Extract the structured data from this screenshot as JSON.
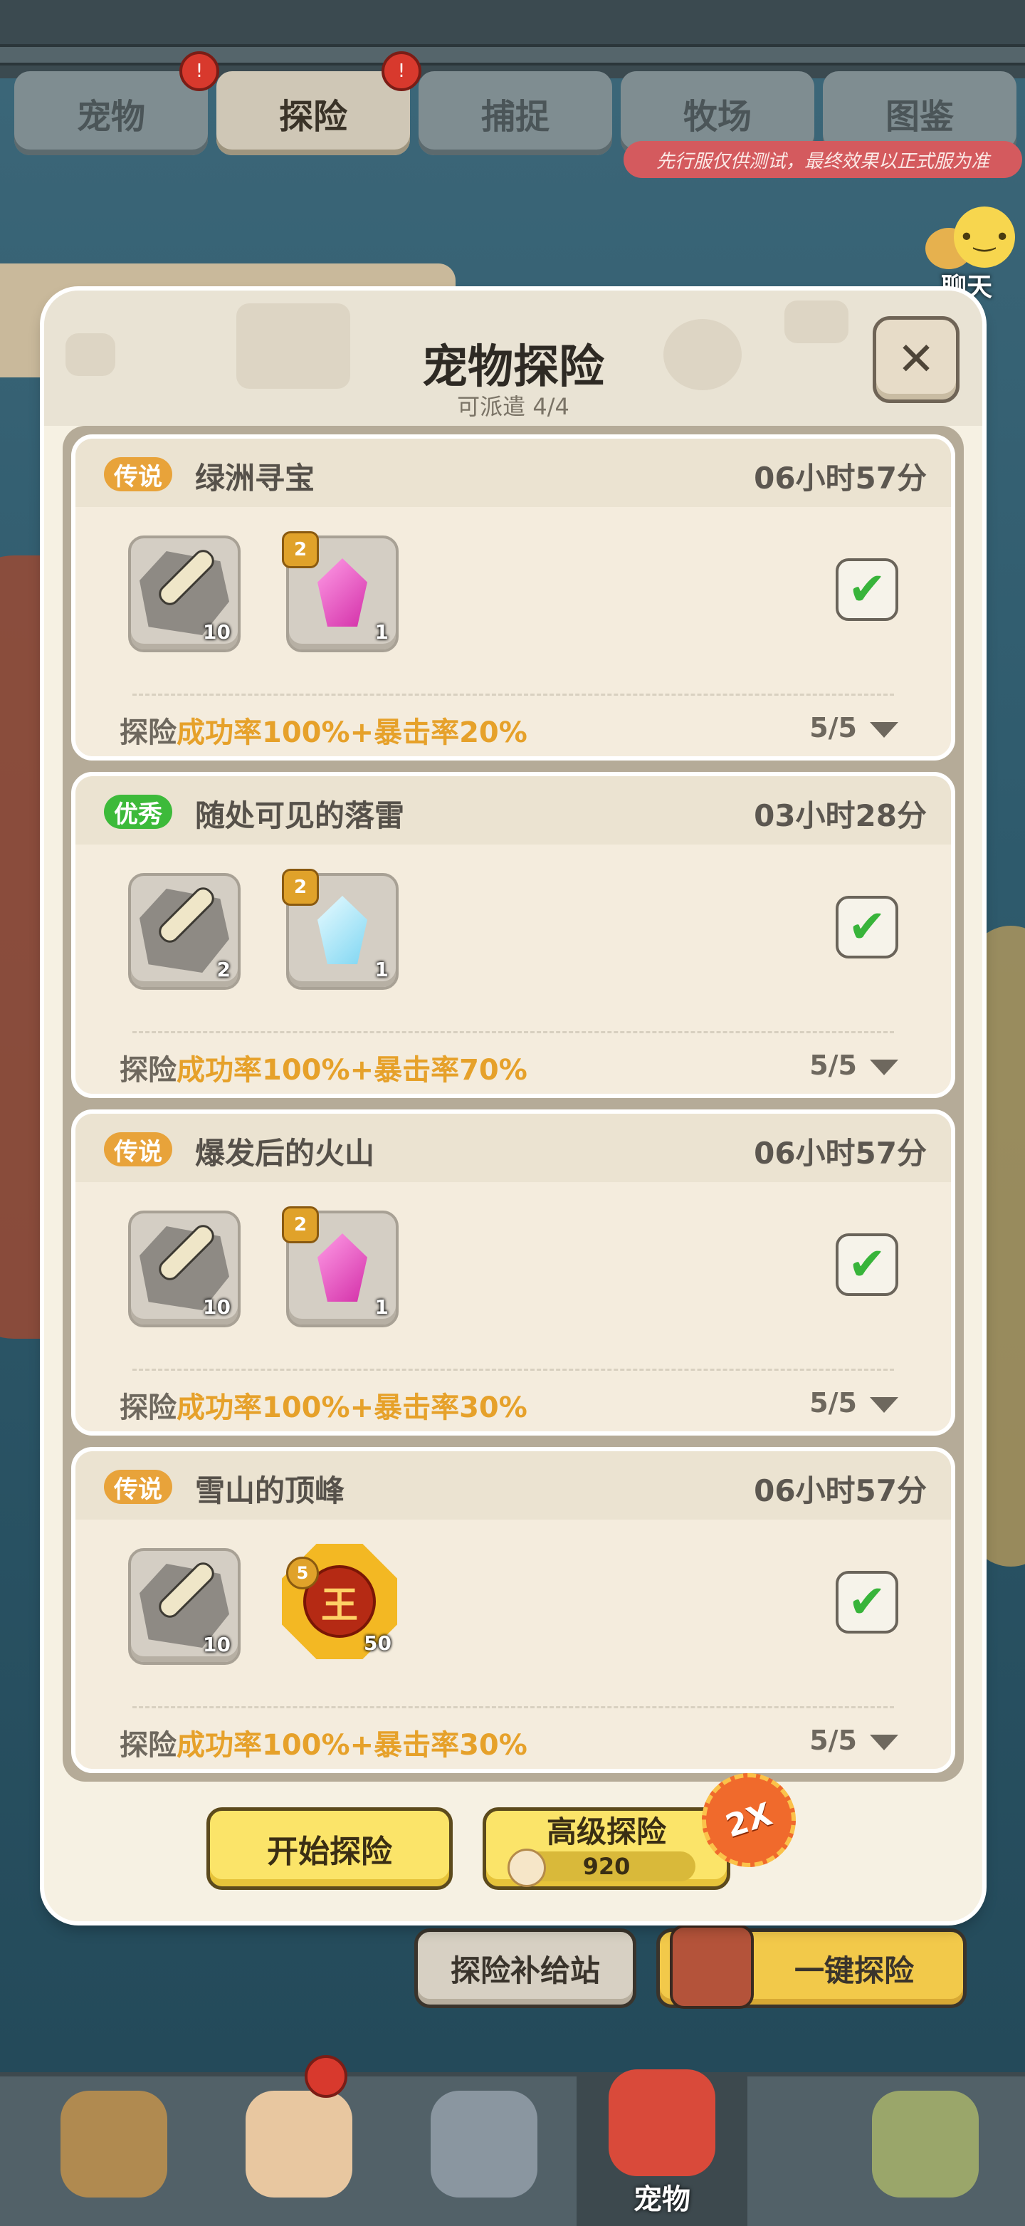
{
  "top_tabs": [
    {
      "label": "宠物",
      "active": false
    },
    {
      "label": "探险",
      "active": true
    },
    {
      "label": "捕捉",
      "active": false
    },
    {
      "label": "牧场",
      "active": false
    },
    {
      "label": "图鉴",
      "active": false
    }
  ],
  "notice": "先行服仅供测试，最终效果以正式服为准",
  "chat": {
    "label": "聊天"
  },
  "dialog": {
    "title": "宠物探险",
    "subtitle": "可派遣 4/4",
    "cards": [
      {
        "rarity": "传说",
        "name": "绿洲寻宝",
        "time": "06小时57分",
        "items": [
          {
            "icon": "bone-icon",
            "qty": "10"
          },
          {
            "icon": "pink-gem-icon",
            "level": "2",
            "qty": "1"
          }
        ],
        "rate_prefix": "探险",
        "rate_text": "成功率100%+暴击率20%",
        "count": "5/5",
        "checked": true
      },
      {
        "rarity": "优秀",
        "name": "随处可见的落雷",
        "time": "03小时28分",
        "items": [
          {
            "icon": "bone-icon",
            "qty": "2"
          },
          {
            "icon": "blue-gem-icon",
            "level": "2",
            "qty": "1"
          }
        ],
        "rate_prefix": "探险",
        "rate_text": "成功率100%+暴击率70%",
        "count": "5/5",
        "checked": true
      },
      {
        "rarity": "传说",
        "name": "爆发后的火山",
        "time": "06小时57分",
        "items": [
          {
            "icon": "bone-icon",
            "qty": "10"
          },
          {
            "icon": "pink-gem-icon",
            "level": "2",
            "qty": "1"
          }
        ],
        "rate_prefix": "探险",
        "rate_text": "成功率100%+暴击率30%",
        "count": "5/5",
        "checked": true
      },
      {
        "rarity": "传说",
        "name": "雪山的顶峰",
        "time": "06小时57分",
        "items": [
          {
            "icon": "bone-icon",
            "qty": "10"
          },
          {
            "icon": "medal-icon",
            "level": "5",
            "qty": "50",
            "glyph": "王"
          }
        ],
        "rate_prefix": "探险",
        "rate_text": "成功率100%+暴击率30%",
        "count": "5/5",
        "checked": true
      }
    ],
    "start_button": "开始探险",
    "advanced_button": {
      "label": "高级探险",
      "cost": "920"
    },
    "double_badge": "2X"
  },
  "under_buttons": {
    "supply": "探险补给站",
    "one_click": "一键探险"
  },
  "bottom_nav": [
    {
      "label": "",
      "icon": "caveman-icon"
    },
    {
      "label": "",
      "icon": "hero-icon",
      "dot": true
    },
    {
      "label": "",
      "icon": "weapon-icon"
    },
    {
      "label": "宠物",
      "icon": "dino-pet-icon",
      "active": true
    },
    {
      "label": "",
      "icon": "totem-icon"
    }
  ],
  "colors": {
    "legend_badge": "#e8a33a",
    "good_badge": "#3dba3a",
    "rate_highlight": "#e6a12a",
    "button_yellow": "#fbe469"
  }
}
